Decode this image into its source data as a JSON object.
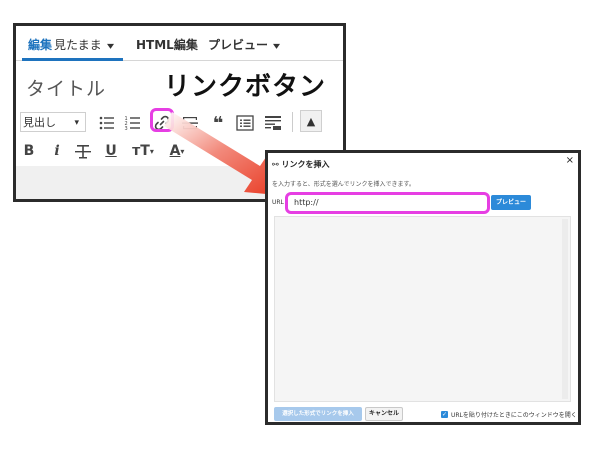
{
  "editor": {
    "tabs": [
      {
        "label": "編集",
        "sub": "見たまま",
        "chevron": "▾",
        "active": true
      },
      {
        "label": "HTML編集",
        "sub": "",
        "chevron": "",
        "active": false
      },
      {
        "label": "プレビュー",
        "sub": "",
        "chevron": "▾",
        "active": false
      }
    ],
    "title_placeholder": "タイトル",
    "format_select": "見出し",
    "toolbar_row2": {
      "bold": "B",
      "italic": "i",
      "underline": "U",
      "fontsize": "тT",
      "color": "A"
    }
  },
  "callout": {
    "title": "リンクボタン",
    "color": "#e63ee3"
  },
  "dialog": {
    "title": "リンクを挿入",
    "close": "×",
    "description": "を入力すると、形式を選んでリンクを挿入できます。",
    "url_label": "URL",
    "url_value": "http://",
    "preview_button": "プレビュー",
    "insert_button": "選択した形式でリンクを挿入",
    "cancel_button": "キャンセル",
    "new_window_label": "URLを貼り付けたときにこのウィンドウを開く"
  },
  "colors": {
    "accent": "#1e73be",
    "highlight": "#e63ee3",
    "arrow": "#e8341c",
    "button_blue": "#2c8ad9"
  }
}
